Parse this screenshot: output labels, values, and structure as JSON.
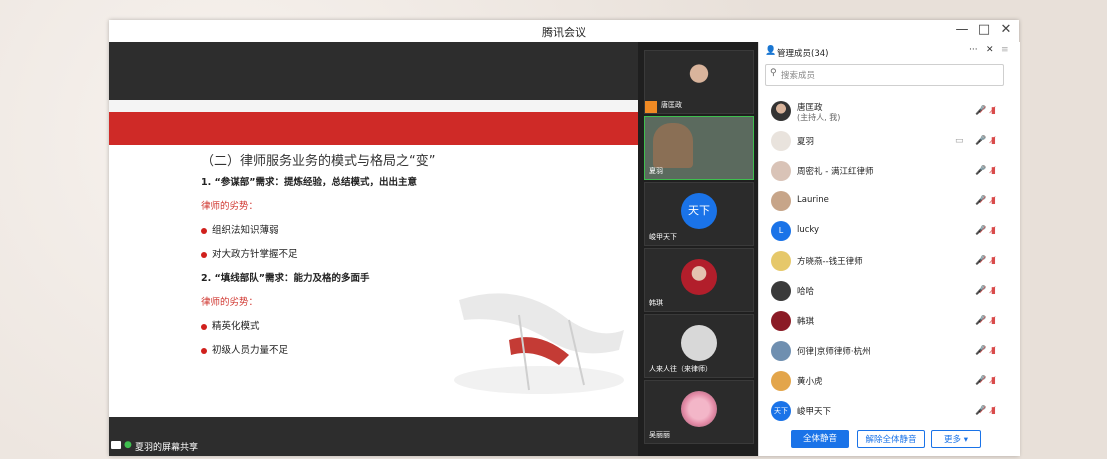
{
  "window": {
    "title": "腾讯会议",
    "minimize": "—",
    "maximize": "□",
    "close": "✕"
  },
  "slide": {
    "heading": "（二）律师服务业务的模式与格局之“变”",
    "line1": "1. “参谋部”需求：提炼经验，总结模式，出出主意",
    "weak1": "律师的劣势：",
    "b1": "组织法知识薄弱",
    "b2": "对大政方针掌握不足",
    "line2": "2. “填线部队”需求：能力及格的多面手",
    "weak2": "律师的劣势：",
    "b3": "精英化模式",
    "b4": "初级人员力量不足"
  },
  "share_status": "夏羽的屏幕共享",
  "videos": [
    {
      "name": "唐匡政"
    },
    {
      "name": "夏羽"
    },
    {
      "name": "峻甲天下",
      "avatar_text": "天下"
    },
    {
      "name": "韩琪"
    },
    {
      "name": "人来人往（来律师）"
    },
    {
      "name": "吴丽丽"
    }
  ],
  "panel": {
    "title": "管理成员(34)",
    "more": "···",
    "close": "✕",
    "menu": "≡",
    "search_placeholder": "搜索成员",
    "members": [
      {
        "name": "唐匡政",
        "sub": "(主持人, 我)"
      },
      {
        "name": "夏羽"
      },
      {
        "name": "周密礼 - 满江红律师"
      },
      {
        "name": "Laurine"
      },
      {
        "name": "lucky",
        "avatar_text": "L"
      },
      {
        "name": "方晓燕--钱王律师"
      },
      {
        "name": "哈哈"
      },
      {
        "name": "韩琪"
      },
      {
        "name": "何律|京师律师·杭州"
      },
      {
        "name": "黄小虎"
      },
      {
        "name": "峻甲天下",
        "avatar_text": "天下"
      }
    ],
    "mute_all": "全体静音",
    "unmute_all": "解除全体静音",
    "more_btn": "更多 ▾"
  },
  "colors": {
    "accent": "#1a73e8",
    "slide_red": "#cf2a27",
    "mic_on": "#3fbf4f"
  }
}
